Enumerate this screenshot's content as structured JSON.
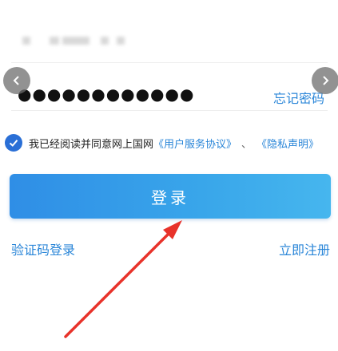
{
  "password": {
    "masked_value": "●●●●●●●●●●●●"
  },
  "forgot_password_label": "忘记密码",
  "agreement": {
    "text": "我已经阅读并同意网上国网",
    "user_agreement_link": "《用户服务协议》",
    "separator": "、",
    "privacy_link": "《隐私声明》"
  },
  "login_button_label": "登录",
  "sms_login_label": "验证码登录",
  "register_label": "立即注册",
  "icons": {
    "left_nav": "chevron-left-icon",
    "right_nav": "chevron-right-icon",
    "check": "check-icon"
  },
  "colors": {
    "accent": "#2a86d8",
    "button_start": "#2f8ee6",
    "button_end": "#46b6ee",
    "check": "#2a6fd6",
    "annotation_arrow": "#e8322a"
  }
}
